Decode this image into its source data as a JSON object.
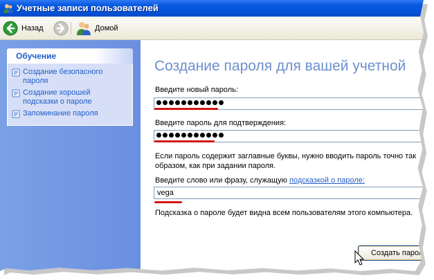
{
  "window": {
    "title": "Учетные записи пользователей"
  },
  "toolbar": {
    "back_label": "Назад",
    "home_label": "Домой"
  },
  "sidebar": {
    "panel_title": "Обучение",
    "items": [
      {
        "label": "Создание безопасного пароля",
        "line1": "Создание безопасного",
        "line2": "пароля"
      },
      {
        "label": "Создание хорошей подсказки о пароле",
        "line1": "Создание хорошей",
        "line2": "подсказки о пароле"
      },
      {
        "label": "Запоминание пароля",
        "line1": "Запоминание пароля",
        "line2": ""
      }
    ]
  },
  "main": {
    "heading": "Создание пароля для вашей учетной",
    "new_password_label": "Введите новый пароль:",
    "new_password_dots": 11,
    "confirm_password_label": "Введите пароль для подтверждения:",
    "confirm_password_dots": 11,
    "caps_note_line1": "Если пароль содержит заглавные буквы, нужно вводить пароль точно так",
    "caps_note_line2": "образом, как при задании пароля.",
    "hint_label_prefix": "Введите слово или фразу, служащую ",
    "hint_label_link": "подсказкой о пароле:",
    "hint_value": "vega",
    "hint_note": "Подсказка о пароле будет видна всем пользователям этого компьютера.",
    "create_button_label": "Создать пароль"
  },
  "colors": {
    "titlebar": "#0352d8",
    "sidebar": "#6b8fe0",
    "link": "#215dc6",
    "heading": "#6d8fcf",
    "annotation_red": "#d11616"
  }
}
